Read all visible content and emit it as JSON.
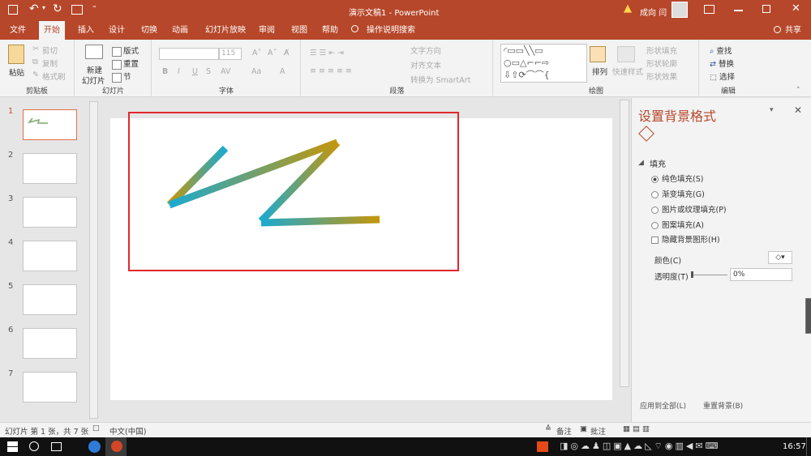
{
  "window": {
    "title": "演示文稿1 - PowerPoint",
    "user": "成向 闫",
    "warning_icon": "warning-icon"
  },
  "qat": {
    "save": "save-icon",
    "undo": "undo-icon",
    "redo": "redo-icon",
    "present": "present-icon",
    "more": "more-icon"
  },
  "tabs": {
    "file": "文件",
    "home": "开始",
    "insert": "插入",
    "design": "设计",
    "transitions": "切换",
    "animations": "动画",
    "slideshow": "幻灯片放映",
    "review": "审阅",
    "view": "视图",
    "help": "帮助",
    "tellme": "操作说明搜索",
    "share": "共享"
  },
  "ribbon": {
    "clipboard": {
      "paste": "粘贴",
      "cut": "剪切",
      "copy": "复制",
      "format_painter": "格式刷",
      "label": "剪贴板"
    },
    "slides": {
      "new_slide": "新建",
      "new_slide2": "幻灯片",
      "layout": "版式",
      "reset": "重置",
      "section": "节",
      "label": "幻灯片"
    },
    "font": {
      "font_name": "",
      "font_size": "115",
      "bold": "B",
      "italic": "I",
      "underline": "U",
      "strike": "S",
      "aa": "Aa",
      "label": "字体"
    },
    "paragraph": {
      "text_direction": "文字方向",
      "align_text": "对齐文本",
      "smartart": "转换为 SmartArt",
      "label": "段落"
    },
    "drawing": {
      "arrange": "排列",
      "quick_styles": "快速样式",
      "shape_fill": "形状填充",
      "shape_outline": "形状轮廓",
      "shape_effects": "形状效果",
      "label": "绘图"
    },
    "editing": {
      "find": "查找",
      "replace": "替换",
      "select": "选择",
      "label": "编辑"
    }
  },
  "thumbnails": [
    "1",
    "2",
    "3",
    "4",
    "5",
    "6",
    "7"
  ],
  "format_pane": {
    "title": "设置背景格式",
    "section": "填充",
    "options": [
      {
        "label": "纯色填充(S)",
        "checked": true
      },
      {
        "label": "渐变填充(G)",
        "checked": false
      },
      {
        "label": "图片或纹理填充(P)",
        "checked": false
      },
      {
        "label": "图案填充(A)",
        "checked": false
      }
    ],
    "hide_bg": "隐藏背景图形(H)",
    "color_label": "颜色(C)",
    "transparency_label": "透明度(T)",
    "transparency_value": "0%",
    "apply_all": "应用到全部(L)",
    "reset_bg": "重置背景(B)"
  },
  "status": {
    "slide_info": "幻灯片 第 1 张，共 7 张",
    "lang": "中文(中国)",
    "notes": "备注",
    "comments": "批注"
  },
  "taskbar": {
    "clock": "16:57"
  },
  "colors": {
    "accent": "#b7472a",
    "red_box": "#e0282d",
    "stroke_cyan": "#1aaad0",
    "stroke_gold": "#c6960a"
  }
}
